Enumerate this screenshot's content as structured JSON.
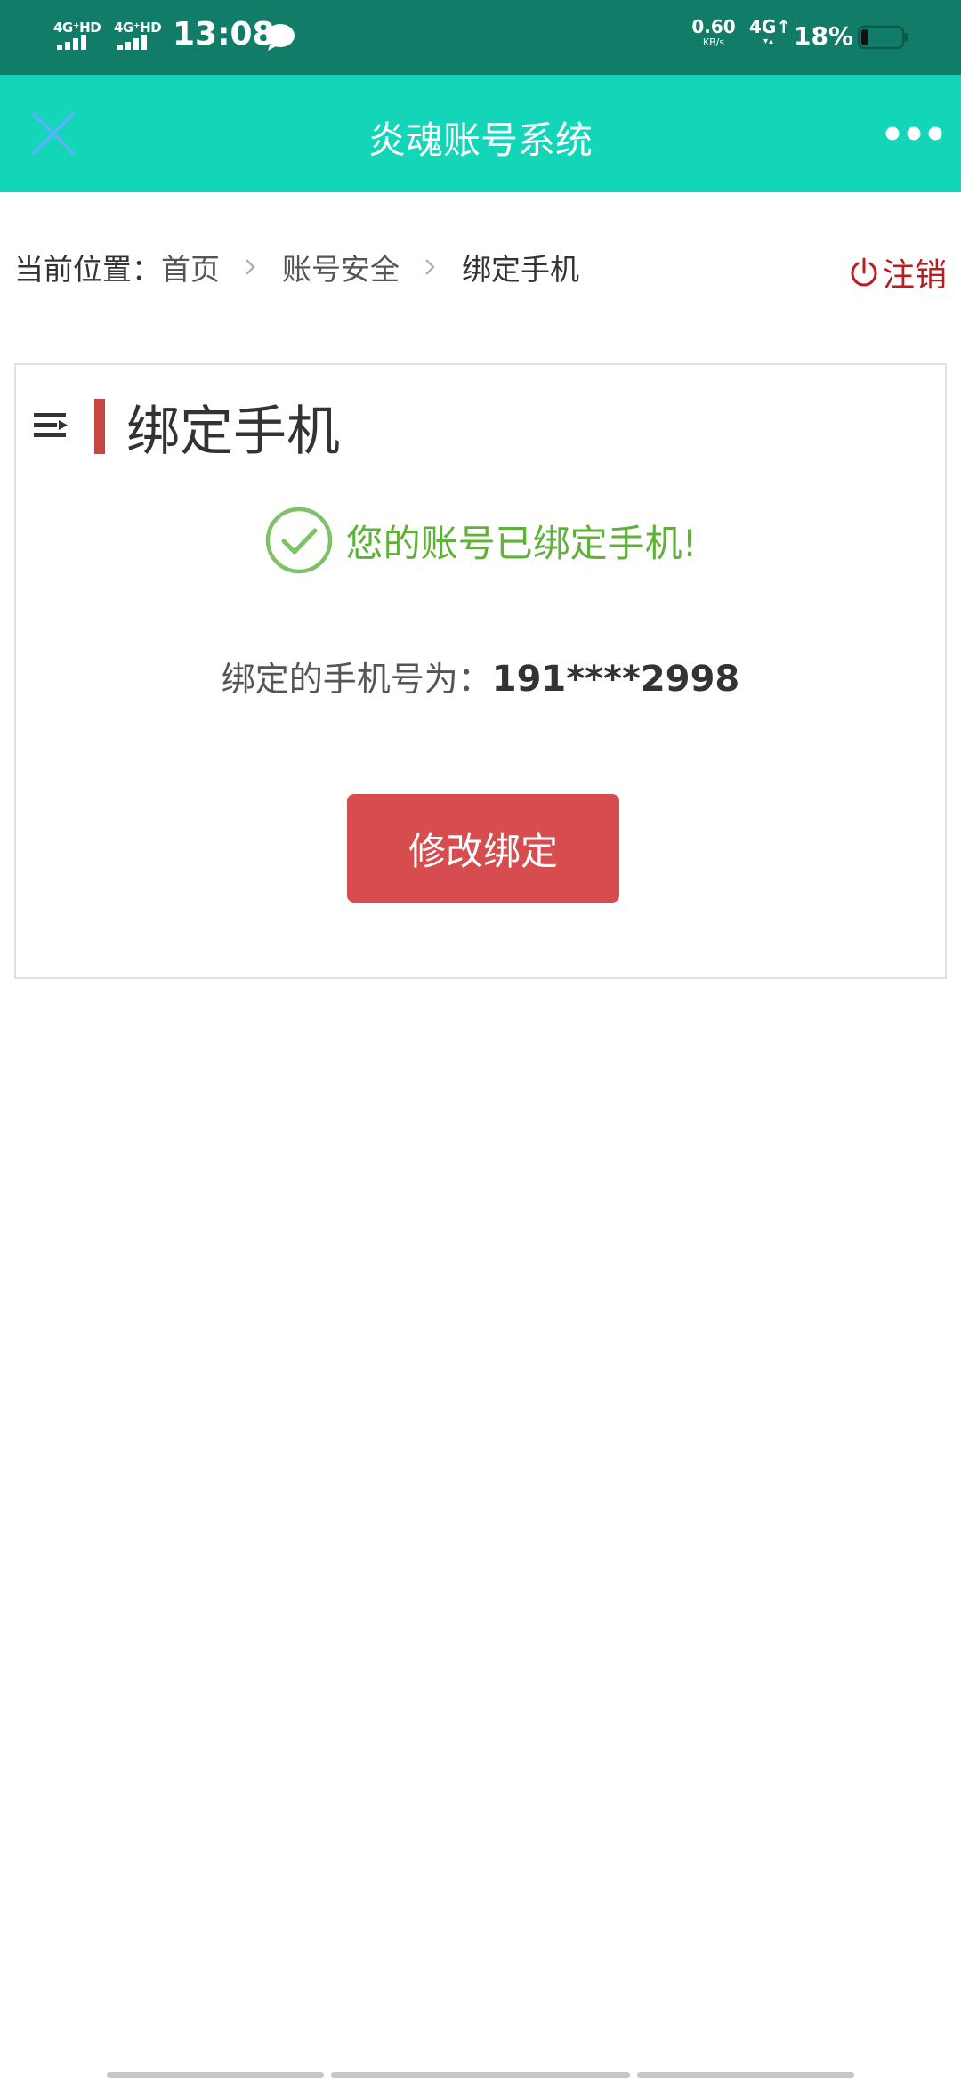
{
  "status_bar": {
    "sim1_network": "4G⁺HD",
    "sim2_network": "4G⁺HD",
    "time": "13:08",
    "speed_value": "0.60",
    "speed_unit": "KB/s",
    "mobile_data": "4G↑",
    "mobile_data_arrows": "▾▴",
    "battery_percent": "18%",
    "battery_level": 0.18
  },
  "header": {
    "title": "炎魂账号系统"
  },
  "breadcrumb": {
    "prefix": "当前位置：",
    "items": [
      "首页",
      "账号安全",
      "绑定手机"
    ],
    "separator": "›"
  },
  "logout": {
    "label": "注销",
    "color": "#b81e1e"
  },
  "card": {
    "title": "绑定手机",
    "success_message": "您的账号已绑定手机!",
    "phone_label": "绑定的手机号为：",
    "phone_number": "191****2998",
    "modify_button_label": "修改绑定"
  },
  "colors": {
    "status_bar": "#117d69",
    "header": "#13d5b8",
    "accent_red": "#d64c4f",
    "success_green": "#5fb13a"
  }
}
